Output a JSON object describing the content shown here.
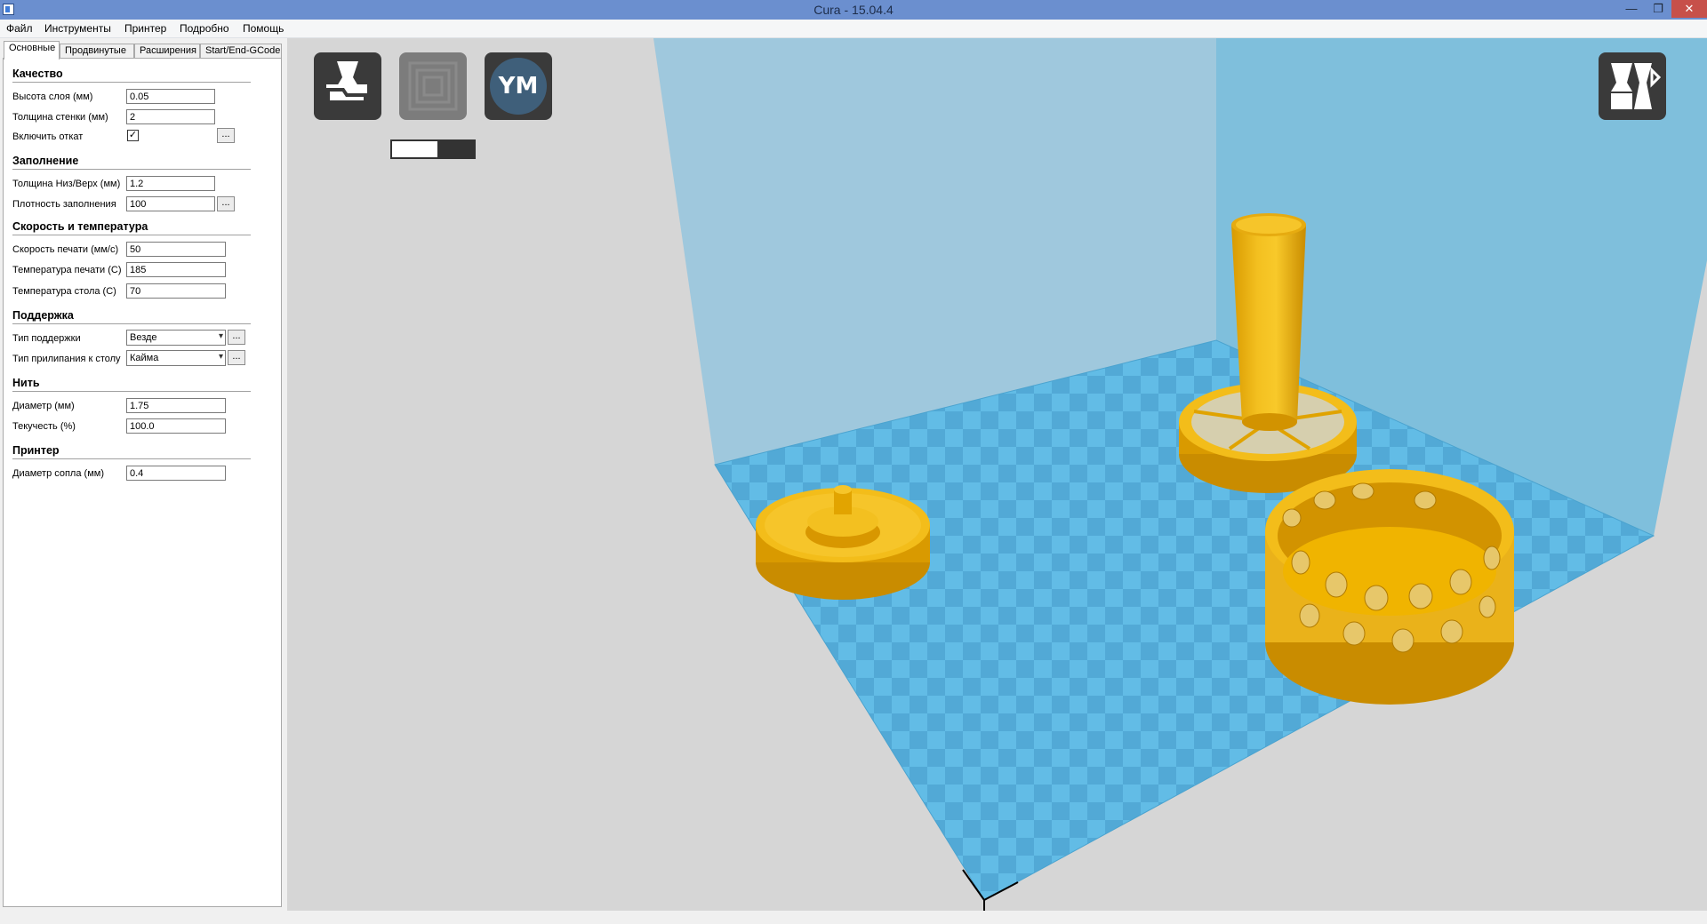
{
  "window": {
    "title": "Cura - 15.04.4",
    "min": "—",
    "max": "❐",
    "close": "✕"
  },
  "menu": [
    "Файл",
    "Инструменты",
    "Принтер",
    "Подробно",
    "Помощь"
  ],
  "tabs": [
    "Основные",
    "Продвинутые",
    "Расширения",
    "Start/End-GCode"
  ],
  "sections": {
    "quality": {
      "title": "Качество",
      "layer_height_label": "Высота слоя (мм)",
      "layer_height": "0.05",
      "wall_thickness_label": "Толщина стенки (мм)",
      "wall_thickness": "2",
      "retraction_label": "Включить откат",
      "retraction": "✓"
    },
    "fill": {
      "title": "Заполнение",
      "bottom_top_label": "Толщина Низ/Верх (мм)",
      "bottom_top": "1.2",
      "density_label": "Плотность заполнения",
      "density": "100"
    },
    "speed": {
      "title": "Скорость и температура",
      "print_speed_label": "Скорость печати (мм/с)",
      "print_speed": "50",
      "print_temp_label": "Температура печати (С)",
      "print_temp": "185",
      "bed_temp_label": "Температура стола (С)",
      "bed_temp": "70"
    },
    "support": {
      "title": "Поддержка",
      "support_type_label": "Тип поддержки",
      "support_type": "Везде",
      "adhesion_label": "Тип прилипания к столу",
      "adhesion": "Кайма"
    },
    "filament": {
      "title": "Нить",
      "diameter_label": "Диаметр (мм)",
      "diameter": "1.75",
      "flow_label": "Текучесть (%)",
      "flow": "100.0"
    },
    "machine": {
      "title": "Принтер",
      "nozzle_label": "Диаметр сопла (мм)",
      "nozzle": "0.4"
    }
  },
  "dots": "...",
  "viewport": {
    "ym_label": "YM",
    "progress_fraction": 0.55,
    "colors": {
      "object": "#f0b400",
      "bed": "#5fb8e3",
      "wall": "#8cc3dd",
      "background": "#d6d6d6"
    }
  }
}
